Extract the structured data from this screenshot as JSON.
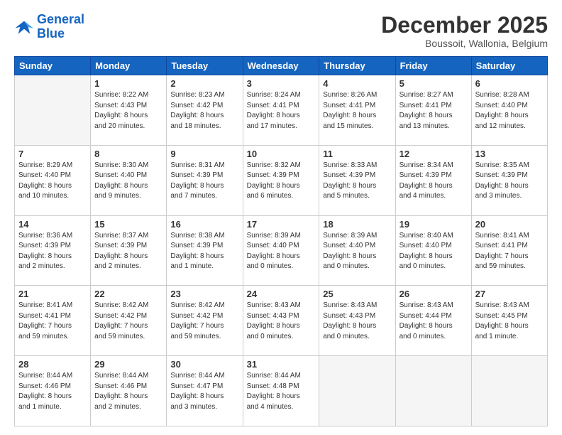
{
  "logo": {
    "line1": "General",
    "line2": "Blue"
  },
  "header": {
    "month": "December 2025",
    "location": "Boussoit, Wallonia, Belgium"
  },
  "weekdays": [
    "Sunday",
    "Monday",
    "Tuesday",
    "Wednesday",
    "Thursday",
    "Friday",
    "Saturday"
  ],
  "weeks": [
    [
      {
        "day": "",
        "info": ""
      },
      {
        "day": "1",
        "info": "Sunrise: 8:22 AM\nSunset: 4:43 PM\nDaylight: 8 hours\nand 20 minutes."
      },
      {
        "day": "2",
        "info": "Sunrise: 8:23 AM\nSunset: 4:42 PM\nDaylight: 8 hours\nand 18 minutes."
      },
      {
        "day": "3",
        "info": "Sunrise: 8:24 AM\nSunset: 4:41 PM\nDaylight: 8 hours\nand 17 minutes."
      },
      {
        "day": "4",
        "info": "Sunrise: 8:26 AM\nSunset: 4:41 PM\nDaylight: 8 hours\nand 15 minutes."
      },
      {
        "day": "5",
        "info": "Sunrise: 8:27 AM\nSunset: 4:41 PM\nDaylight: 8 hours\nand 13 minutes."
      },
      {
        "day": "6",
        "info": "Sunrise: 8:28 AM\nSunset: 4:40 PM\nDaylight: 8 hours\nand 12 minutes."
      }
    ],
    [
      {
        "day": "7",
        "info": "Sunrise: 8:29 AM\nSunset: 4:40 PM\nDaylight: 8 hours\nand 10 minutes."
      },
      {
        "day": "8",
        "info": "Sunrise: 8:30 AM\nSunset: 4:40 PM\nDaylight: 8 hours\nand 9 minutes."
      },
      {
        "day": "9",
        "info": "Sunrise: 8:31 AM\nSunset: 4:39 PM\nDaylight: 8 hours\nand 7 minutes."
      },
      {
        "day": "10",
        "info": "Sunrise: 8:32 AM\nSunset: 4:39 PM\nDaylight: 8 hours\nand 6 minutes."
      },
      {
        "day": "11",
        "info": "Sunrise: 8:33 AM\nSunset: 4:39 PM\nDaylight: 8 hours\nand 5 minutes."
      },
      {
        "day": "12",
        "info": "Sunrise: 8:34 AM\nSunset: 4:39 PM\nDaylight: 8 hours\nand 4 minutes."
      },
      {
        "day": "13",
        "info": "Sunrise: 8:35 AM\nSunset: 4:39 PM\nDaylight: 8 hours\nand 3 minutes."
      }
    ],
    [
      {
        "day": "14",
        "info": "Sunrise: 8:36 AM\nSunset: 4:39 PM\nDaylight: 8 hours\nand 2 minutes."
      },
      {
        "day": "15",
        "info": "Sunrise: 8:37 AM\nSunset: 4:39 PM\nDaylight: 8 hours\nand 2 minutes."
      },
      {
        "day": "16",
        "info": "Sunrise: 8:38 AM\nSunset: 4:39 PM\nDaylight: 8 hours\nand 1 minute."
      },
      {
        "day": "17",
        "info": "Sunrise: 8:39 AM\nSunset: 4:40 PM\nDaylight: 8 hours\nand 0 minutes."
      },
      {
        "day": "18",
        "info": "Sunrise: 8:39 AM\nSunset: 4:40 PM\nDaylight: 8 hours\nand 0 minutes."
      },
      {
        "day": "19",
        "info": "Sunrise: 8:40 AM\nSunset: 4:40 PM\nDaylight: 8 hours\nand 0 minutes."
      },
      {
        "day": "20",
        "info": "Sunrise: 8:41 AM\nSunset: 4:41 PM\nDaylight: 7 hours\nand 59 minutes."
      }
    ],
    [
      {
        "day": "21",
        "info": "Sunrise: 8:41 AM\nSunset: 4:41 PM\nDaylight: 7 hours\nand 59 minutes."
      },
      {
        "day": "22",
        "info": "Sunrise: 8:42 AM\nSunset: 4:42 PM\nDaylight: 7 hours\nand 59 minutes."
      },
      {
        "day": "23",
        "info": "Sunrise: 8:42 AM\nSunset: 4:42 PM\nDaylight: 7 hours\nand 59 minutes."
      },
      {
        "day": "24",
        "info": "Sunrise: 8:43 AM\nSunset: 4:43 PM\nDaylight: 8 hours\nand 0 minutes."
      },
      {
        "day": "25",
        "info": "Sunrise: 8:43 AM\nSunset: 4:43 PM\nDaylight: 8 hours\nand 0 minutes."
      },
      {
        "day": "26",
        "info": "Sunrise: 8:43 AM\nSunset: 4:44 PM\nDaylight: 8 hours\nand 0 minutes."
      },
      {
        "day": "27",
        "info": "Sunrise: 8:43 AM\nSunset: 4:45 PM\nDaylight: 8 hours\nand 1 minute."
      }
    ],
    [
      {
        "day": "28",
        "info": "Sunrise: 8:44 AM\nSunset: 4:46 PM\nDaylight: 8 hours\nand 1 minute."
      },
      {
        "day": "29",
        "info": "Sunrise: 8:44 AM\nSunset: 4:46 PM\nDaylight: 8 hours\nand 2 minutes."
      },
      {
        "day": "30",
        "info": "Sunrise: 8:44 AM\nSunset: 4:47 PM\nDaylight: 8 hours\nand 3 minutes."
      },
      {
        "day": "31",
        "info": "Sunrise: 8:44 AM\nSunset: 4:48 PM\nDaylight: 8 hours\nand 4 minutes."
      },
      {
        "day": "",
        "info": ""
      },
      {
        "day": "",
        "info": ""
      },
      {
        "day": "",
        "info": ""
      }
    ]
  ]
}
